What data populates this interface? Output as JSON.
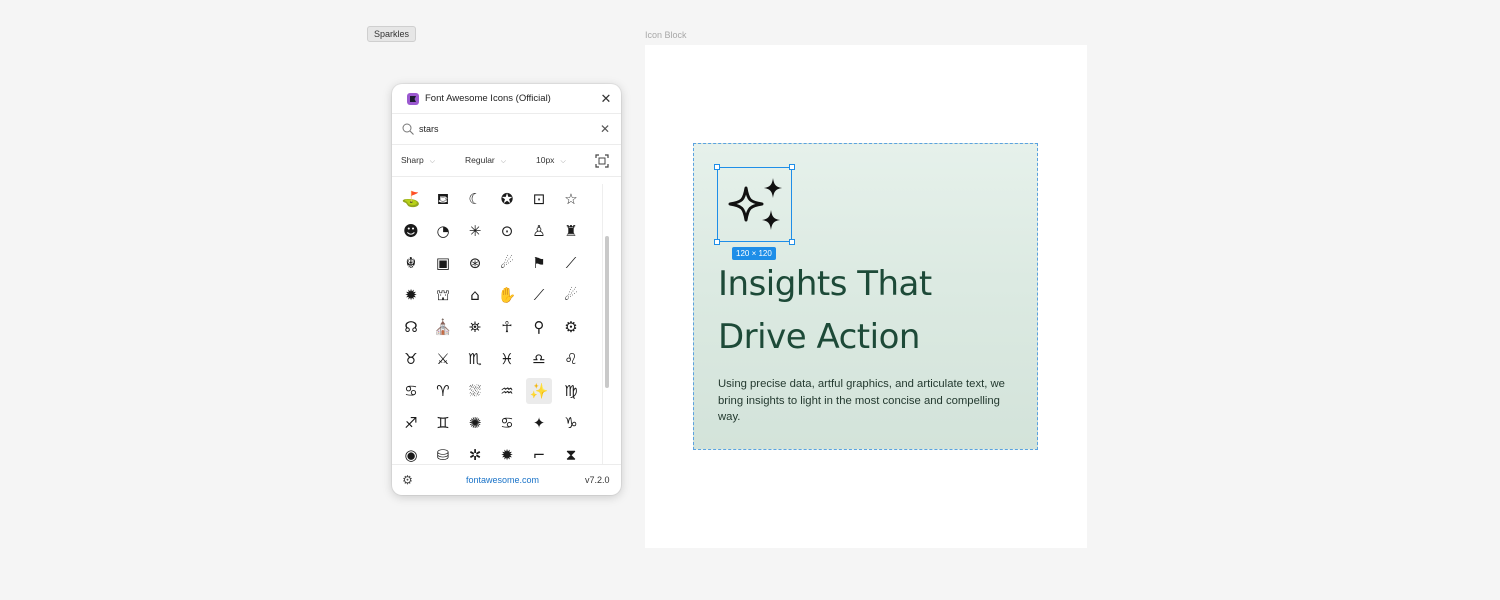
{
  "tooltip": "Sparkles",
  "frame": {
    "label": "Icon Block"
  },
  "block": {
    "size_badge": "120 × 120",
    "headline": "Insights That Drive Action",
    "body": "Using precise data, artful graphics, and articulate text, we bring insights to light in the most concise and compelling way.",
    "selected_icon": "sparkles-icon",
    "selection_color": "#1e8ee8",
    "headline_color": "#1d4a38"
  },
  "plugin": {
    "title": "Font Awesome Icons (Official)",
    "search": {
      "value": "stars",
      "placeholder": ""
    },
    "filters": {
      "family": "Sharp",
      "style": "Regular",
      "size": "10px"
    },
    "icons": [
      {
        "glyph": "⛳",
        "name": "ranking-star-icon"
      },
      {
        "glyph": "⛾",
        "name": "cup-star-icon"
      },
      {
        "glyph": "☾",
        "name": "moon-stars-icon"
      },
      {
        "glyph": "✪",
        "name": "circle-star-icon"
      },
      {
        "glyph": "⊡",
        "name": "calendar-star-icon"
      },
      {
        "glyph": "☆",
        "name": "hand-star-icon"
      },
      {
        "glyph": "☻",
        "name": "face-grin-stars-icon"
      },
      {
        "glyph": "◔",
        "name": "planet-icon"
      },
      {
        "glyph": "✳",
        "name": "asterisk-icon"
      },
      {
        "glyph": "⊙",
        "name": "tie-fighter-icon"
      },
      {
        "glyph": "♙",
        "name": "astronaut-icon"
      },
      {
        "glyph": "♜",
        "name": "castle-icon"
      },
      {
        "glyph": "☬",
        "name": "jedi-order-icon"
      },
      {
        "glyph": "▣",
        "name": "book-icon"
      },
      {
        "glyph": "⊛",
        "name": "eye-galaxy-icon"
      },
      {
        "glyph": "☄",
        "name": "meteor-icon"
      },
      {
        "glyph": "⚑",
        "name": "flag-usa-icon"
      },
      {
        "glyph": "⟋",
        "name": "lightsaber-icon"
      },
      {
        "glyph": "✹",
        "name": "starburst-icon"
      },
      {
        "glyph": "⛫",
        "name": "robot-icon"
      },
      {
        "glyph": "⌂",
        "name": "house-star-icon"
      },
      {
        "glyph": "✋",
        "name": "hand-sparkles-icon"
      },
      {
        "glyph": "⟋",
        "name": "saber-icon"
      },
      {
        "glyph": "☄",
        "name": "comet-icon"
      },
      {
        "glyph": "☊",
        "name": "galaxy-icon"
      },
      {
        "glyph": "⛪",
        "name": "building-icon"
      },
      {
        "glyph": "⛯",
        "name": "droid-icon"
      },
      {
        "glyph": "☥",
        "name": "alien-icon"
      },
      {
        "glyph": "⚲",
        "name": "ufo-icon"
      },
      {
        "glyph": "⚙",
        "name": "sun-gear-icon"
      },
      {
        "glyph": "♉",
        "name": "taurus-icon"
      },
      {
        "glyph": "⚔",
        "name": "swords-icon"
      },
      {
        "glyph": "♏",
        "name": "scorpio-icon"
      },
      {
        "glyph": "♓",
        "name": "pisces-icon"
      },
      {
        "glyph": "♎",
        "name": "libra-icon"
      },
      {
        "glyph": "♌",
        "name": "leo-icon"
      },
      {
        "glyph": "♋",
        "name": "cancer-icon"
      },
      {
        "glyph": "♈",
        "name": "aries-icon"
      },
      {
        "glyph": "⛆",
        "name": "tree-icon"
      },
      {
        "glyph": "♒",
        "name": "aquarius-icon"
      },
      {
        "glyph": "✨",
        "name": "sparkles-icon",
        "selected": true
      },
      {
        "glyph": "♍",
        "name": "virgo-icon"
      },
      {
        "glyph": "♐",
        "name": "sagittarius-icon"
      },
      {
        "glyph": "♊",
        "name": "gemini-icon"
      },
      {
        "glyph": "✺",
        "name": "spiral-galaxy-icon"
      },
      {
        "glyph": "♋",
        "name": "wind-icon"
      },
      {
        "glyph": "✦",
        "name": "sparkle-icon"
      },
      {
        "glyph": "♑",
        "name": "capricorn-icon"
      },
      {
        "glyph": "◉",
        "name": "eye-icon"
      },
      {
        "glyph": "⛁",
        "name": "user-astronaut-icon"
      },
      {
        "glyph": "✲",
        "name": "star-gear-icon"
      },
      {
        "glyph": "✹",
        "name": "sun-icon"
      },
      {
        "glyph": "⌐",
        "name": "stairs-icon"
      },
      {
        "glyph": "⧗",
        "name": "hourglass-icon"
      }
    ],
    "footer": {
      "link": "fontawesome.com",
      "version": "v7.2.0"
    }
  }
}
